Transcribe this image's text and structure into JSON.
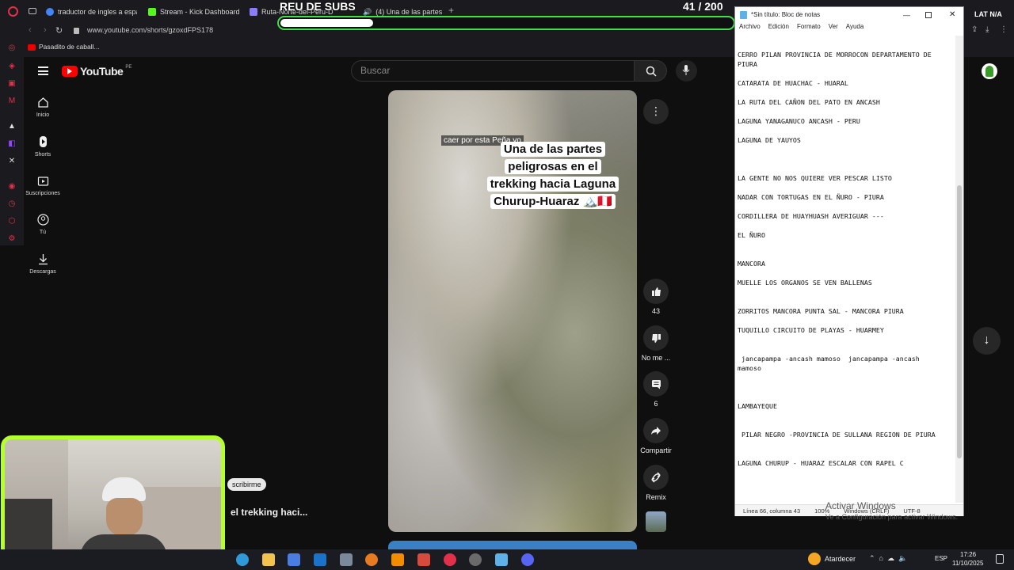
{
  "browser": {
    "tabs": [
      {
        "label": "traductor de ingles a espa",
        "icon": "google-icon",
        "color": "#4285f4"
      },
      {
        "label": "Stream - Kick Dashboard",
        "icon": "kick-icon",
        "color": "#53fc18"
      },
      {
        "label": "Ruta-Norte-del-Peru-D",
        "icon": "page-icon",
        "color": "#8a7cff"
      },
      {
        "label": "(4) Una de las partes",
        "icon": "speaker-icon",
        "color": "#e0e0e0"
      }
    ],
    "url": "www.youtube.com/shorts/gzoxdFPS178",
    "bookmark": "Pasadito de caball..."
  },
  "overlay": {
    "title": "REU DE SUBS",
    "counter": "41 / 200",
    "progress_fraction": 0.205,
    "region": "LAT N/A"
  },
  "youtube": {
    "logo": "YouTube",
    "region": "PE",
    "search_placeholder": "Buscar",
    "nav": [
      {
        "label": "Inicio",
        "icon": "home-icon"
      },
      {
        "label": "Shorts",
        "icon": "shorts-icon"
      },
      {
        "label": "Suscripciones",
        "icon": "subscriptions-icon"
      },
      {
        "label": "Tú",
        "icon": "user-icon"
      },
      {
        "label": "Descargas",
        "icon": "download-icon"
      }
    ],
    "caption_small": "caer por esta Peña yo",
    "caption_big": [
      "Una de las partes",
      "peligrosas en el",
      "trekking hacia Laguna",
      "Churup-Huaraz 🏔️🇵🇪"
    ],
    "actions": {
      "likes": "43",
      "dislike_label": "No me ...",
      "comments": "6",
      "share_label": "Compartir",
      "remix_label": "Remix"
    },
    "subscribe_partial": "scribirme",
    "title_partial": "el trekking haci..."
  },
  "notepad": {
    "title": "*Sin título: Bloc de notas",
    "menu": [
      "Archivo",
      "Edición",
      "Formato",
      "Ver",
      "Ayuda"
    ],
    "content": "CERRO PILAN PROVINCIA DE MORROCON DEPARTAMENTO DE\nPIURA\n\nCATARATA DE HUACHAC - HUARAL\n\nLA RUTA DEL CAÑON DEL PATO EN ANCASH\n\nLAGUNA YANAGANUCO ANCASH - PERU\n\nLAGUNA DE YAUYOS\n\n\n\nLA GENTE NO NOS QUIERE VER PESCAR LISTO\n\nNADAR CON TORTUGAS EN EL ÑURO - PIURA\n\nCORDILLERA DE HUAYHUASH AVERIGUAR ---\n\nEL ÑURO\n\n\nMANCORA\n\nMUELLE LOS ORGANOS SE VEN BALLENAS\n\n\nZORRITOS MANCORA PUNTA SAL - MANCORA PIURA\n\nTUQUILLO CIRCUITO DE PLAYAS - HUARMEY\n\n\n jancapampa -ancash mamoso  jancapampa -ancash\nmamoso\n\n\n\nLAMBAYEQUE\n\n\n PILAR NEGRO -PROVINCIA DE SULLANA REGION DE PIURA\n\n\nLAGUNA CHURUP - HUARAZ ESCALAR CON RAPEL C",
    "status": {
      "position": "Línea 66, columna 43",
      "zoom": "100%",
      "eol": "Windows (CRLF)",
      "encoding": "UTF-8"
    }
  },
  "windows": {
    "watermark_title": "Activar Windows",
    "watermark_sub": "Ve a Configuración para activar Windows.",
    "weather": "Atardecer",
    "lang": "ESP",
    "time": "17:26",
    "date": "11/10/2025"
  }
}
